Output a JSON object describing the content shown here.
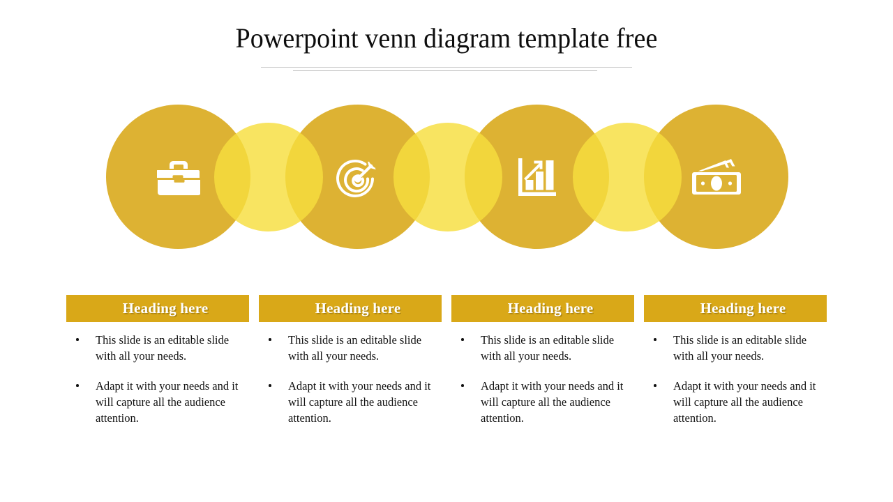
{
  "slide": {
    "background_color": "#FFFFFF",
    "title": "Powerpoint venn diagram template free",
    "divider_color": "#C9C9C9"
  },
  "theme": {
    "circle_main_color": "#DDB233",
    "circle_link_color": "#F7DE3E",
    "circle_overlap_color": "#EFD03F",
    "heading_bar_color": "#D9A818",
    "heading_text_color": "#FFFFFF",
    "icon_color": "#FFFFFF",
    "body_text_color": "#121212"
  },
  "venn": {
    "main_circles": [
      {
        "icon": "briefcase-icon",
        "label": "Briefcase"
      },
      {
        "icon": "target-arrow-icon",
        "label": "Target with arrow"
      },
      {
        "icon": "bar-chart-growth-icon",
        "label": "Growth bar chart"
      },
      {
        "icon": "money-cash-icon",
        "label": "Cash banknotes"
      }
    ],
    "link_circles": [
      {
        "name": "overlap-circle-1"
      },
      {
        "name": "overlap-circle-2"
      },
      {
        "name": "overlap-circle-3"
      }
    ]
  },
  "columns": [
    {
      "heading": "Heading here",
      "bullets": [
        "This slide is an editable slide with all your needs.",
        "Adapt it with your needs and it will capture all the audience attention."
      ]
    },
    {
      "heading": "Heading here",
      "bullets": [
        "This slide is an editable slide with all your needs.",
        "Adapt it with your needs and it will capture all the audience attention."
      ]
    },
    {
      "heading": "Heading here",
      "bullets": [
        "This slide is an editable slide with all your needs.",
        "Adapt it with your needs and it will capture all the audience attention."
      ]
    },
    {
      "heading": "Heading here",
      "bullets": [
        "This slide is an editable slide with all your needs.",
        "Adapt it with your needs and it will capture all the audience attention."
      ]
    }
  ]
}
